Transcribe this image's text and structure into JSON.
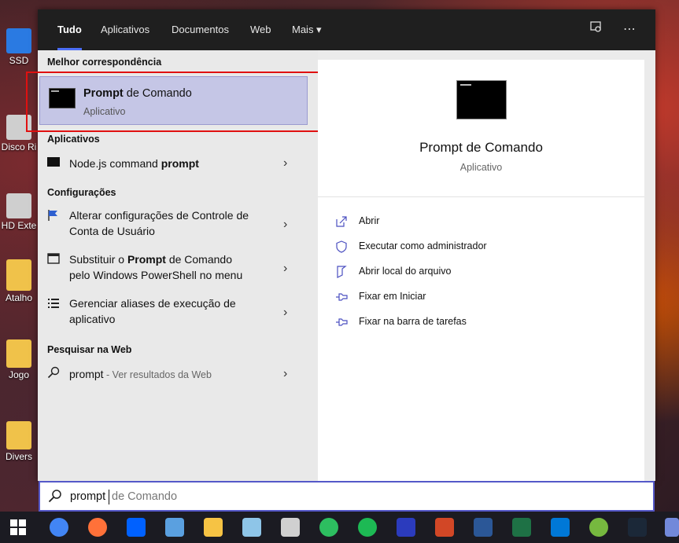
{
  "desktop": {
    "icons": [
      {
        "label": "SSD",
        "color": "#2a7ae2"
      },
      {
        "label": "Disco Ri",
        "color": "#cfcfcf"
      },
      {
        "label": "HD Exte",
        "color": "#cfcfcf"
      },
      {
        "label": "Atalho",
        "color": "#f0c24a"
      },
      {
        "label": "Jogo",
        "color": "#f0c24a"
      },
      {
        "label": "Divers",
        "color": "#f0c24a"
      }
    ]
  },
  "tabs": [
    {
      "label": "Tudo"
    },
    {
      "label": "Aplicativos"
    },
    {
      "label": "Documentos"
    },
    {
      "label": "Web"
    },
    {
      "label": "Mais ▾"
    }
  ],
  "left": {
    "best_match_title": "Melhor correspondência",
    "best": {
      "title_bold": "Prompt",
      "title_rest": " de Comando",
      "subtitle": "Aplicativo"
    },
    "apps_title": "Aplicativos",
    "apps": [
      {
        "pre": "Node.js command ",
        "bold": "prompt",
        "post": ""
      }
    ],
    "settings_title": "Configurações",
    "settings": [
      {
        "line1": "Alterar configurações de Controle de",
        "line2": "Conta de Usuário",
        "icon": "flag-icon"
      },
      {
        "line1a": "Substituir o ",
        "line1b": "Prompt",
        "line1c": " de Comando",
        "line2": "pelo Windows PowerShell no menu",
        "icon": "window-icon"
      },
      {
        "line1": "Gerenciar aliases de execução de",
        "line2": "aplicativo",
        "icon": "list-icon"
      }
    ],
    "web_title": "Pesquisar na Web",
    "web": {
      "query": "prompt",
      "hint": " - Ver resultados da Web"
    }
  },
  "right": {
    "title": "Prompt de Comando",
    "subtitle": "Aplicativo",
    "actions": [
      {
        "label": "Abrir"
      },
      {
        "label": "Executar como administrador"
      },
      {
        "label": "Abrir local do arquivo"
      },
      {
        "label": "Fixar em Iniciar"
      },
      {
        "label": "Fixar na barra de tarefas"
      }
    ]
  },
  "search": {
    "typed": "prompt",
    "suggestion": "de Comando"
  },
  "taskbar": {
    "apps": [
      {
        "name": "chrome-icon",
        "color": "#4285f4"
      },
      {
        "name": "firefox-icon",
        "color": "#ff7139"
      },
      {
        "name": "dropbox-icon",
        "color": "#0061ff"
      },
      {
        "name": "computer-icon",
        "color": "#5aa0e0"
      },
      {
        "name": "file-explorer-icon",
        "color": "#f6c344"
      },
      {
        "name": "notepad-icon",
        "color": "#8ec5e8"
      },
      {
        "name": "calculator-icon",
        "color": "#d0d0d0"
      },
      {
        "name": "evernote-icon",
        "color": "#2dbe60"
      },
      {
        "name": "spotify-icon",
        "color": "#1db954"
      },
      {
        "name": "photoshop-icon",
        "color": "#2b3bbd"
      },
      {
        "name": "powerpoint-icon",
        "color": "#d24726"
      },
      {
        "name": "word-icon",
        "color": "#2b5797"
      },
      {
        "name": "excel-icon",
        "color": "#1e7145"
      },
      {
        "name": "vscode-icon",
        "color": "#0078d7"
      },
      {
        "name": "utorrent-icon",
        "color": "#76b83f"
      },
      {
        "name": "steam-icon",
        "color": "#1b2838"
      },
      {
        "name": "discord-icon",
        "color": "#7289da"
      }
    ]
  }
}
